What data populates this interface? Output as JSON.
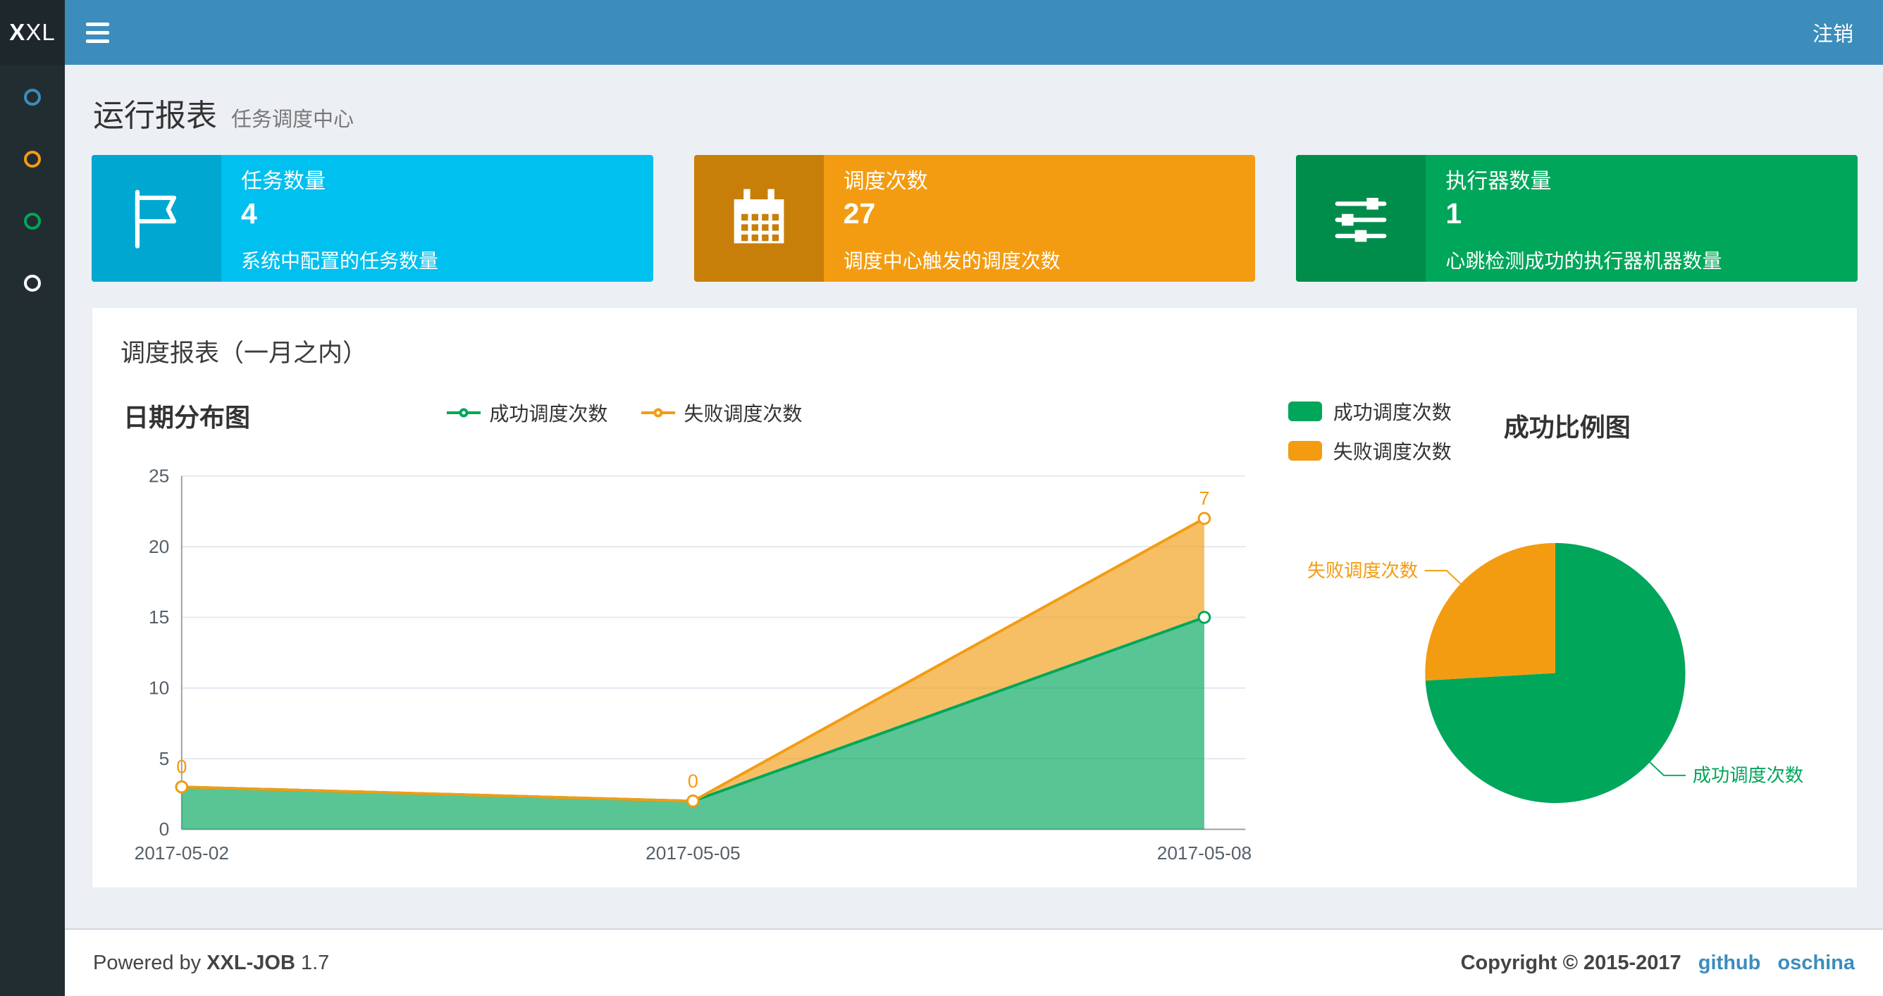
{
  "navbar": {
    "logo_bold": "X",
    "logo_rest": "XL",
    "logout_label": "注销"
  },
  "sidebar": {
    "items": [
      {
        "icon": "circle-icon",
        "color": "#3c8dbc"
      },
      {
        "icon": "circle-icon",
        "color": "#f39c12"
      },
      {
        "icon": "circle-icon",
        "color": "#00a65a"
      },
      {
        "icon": "circle-icon",
        "color": "#ffffff"
      }
    ]
  },
  "page_header": {
    "title": "运行报表",
    "subtitle": "任务调度中心"
  },
  "info_boxes": [
    {
      "title": "任务数量",
      "value": "4",
      "description": "系统中配置的任务数量",
      "bg": "#00c0ef",
      "icon_bg": "#00a7d0",
      "icon": "flag-icon"
    },
    {
      "title": "调度次数",
      "value": "27",
      "description": "调度中心触发的调度次数",
      "bg": "#f39c12",
      "icon_bg": "#c87f0a",
      "icon": "calendar-icon"
    },
    {
      "title": "执行器数量",
      "value": "1",
      "description": "心跳检测成功的执行器机器数量",
      "bg": "#00a65a",
      "icon_bg": "#008d4c",
      "icon": "sliders-icon"
    }
  ],
  "panel": {
    "title": "调度报表（一月之内）"
  },
  "chart_data": [
    {
      "type": "area",
      "title": "日期分布图",
      "x": [
        "2017-05-02",
        "2017-05-05",
        "2017-05-08"
      ],
      "series": [
        {
          "name": "成功调度次数",
          "values": [
            3,
            2,
            15
          ],
          "color": "#00a65a"
        },
        {
          "name": "失败调度次数",
          "values": [
            0,
            0,
            7
          ],
          "color": "#f39c12"
        }
      ],
      "stacked": true,
      "point_labels_series": 1,
      "point_labels": [
        "0",
        "0",
        "7"
      ],
      "ylim": [
        0,
        25
      ],
      "yticks": [
        0,
        5,
        10,
        15,
        20,
        25
      ],
      "grid": true,
      "legend_position": "top-center"
    },
    {
      "type": "pie",
      "title": "成功比例图",
      "slices": [
        {
          "label": "成功调度次数",
          "value": 20,
          "color": "#00a65a"
        },
        {
          "label": "失败调度次数",
          "value": 7,
          "color": "#f39c12"
        }
      ],
      "legend_position": "top-left"
    }
  ],
  "footer": {
    "powered_prefix": "Powered by",
    "product": "XXL-JOB",
    "version": "1.7",
    "copyright": "Copyright © 2015-2017",
    "link_github": "github",
    "link_oschina": "oschina"
  },
  "colors": {
    "navbar": "#3c8dbc",
    "sidebar_bg": "#222d32",
    "content_bg": "#ecf0f5"
  }
}
